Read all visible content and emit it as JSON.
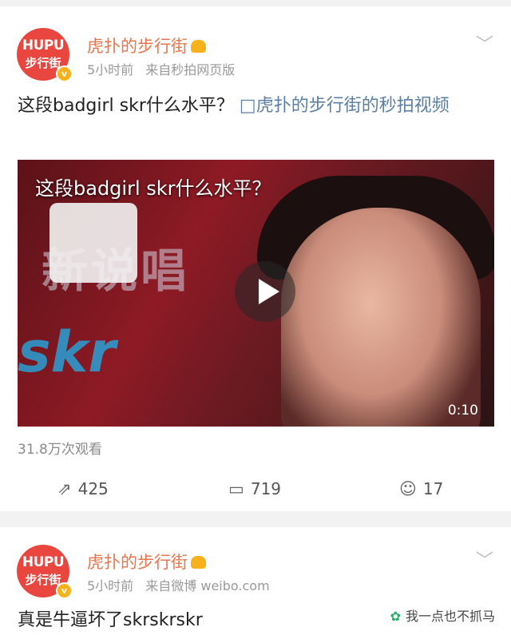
{
  "post1": {
    "avatar": {
      "line1": "HUPU",
      "line2": "步行街",
      "badge": "v"
    },
    "author": "虎扑的步行街",
    "time": "5小时前",
    "source": "来自秒拍网页版",
    "text": "这段badgirl skr什么水平？",
    "link_icon": "□",
    "link_text": "虎扑的步行街的秒拍视频",
    "video": {
      "caption": "这段badgirl skr什么水平？",
      "stage_text": "新说唱",
      "skr_text": "skr",
      "duration": "0:10"
    },
    "views": "31.8万次观看",
    "actions": {
      "share": "425",
      "comment": "719",
      "like": "17"
    }
  },
  "post2": {
    "avatar": {
      "line1": "HUPU",
      "line2": "步行街",
      "badge": "v"
    },
    "author": "虎扑的步行街",
    "time": "5小时前",
    "source": "来自微博 weibo.com",
    "text": "真是牛逼坏了skrskrskr"
  },
  "watermark": "我一点也不抓马",
  "icons": {
    "chevron": "chevron-down-icon",
    "share": "share-icon",
    "comment": "comment-icon",
    "like": "like-icon",
    "play": "play-icon"
  },
  "colors": {
    "author": "#e8754b",
    "link": "#5b7fa6",
    "avatar": "#e8463e",
    "badge": "#f7b21b"
  }
}
